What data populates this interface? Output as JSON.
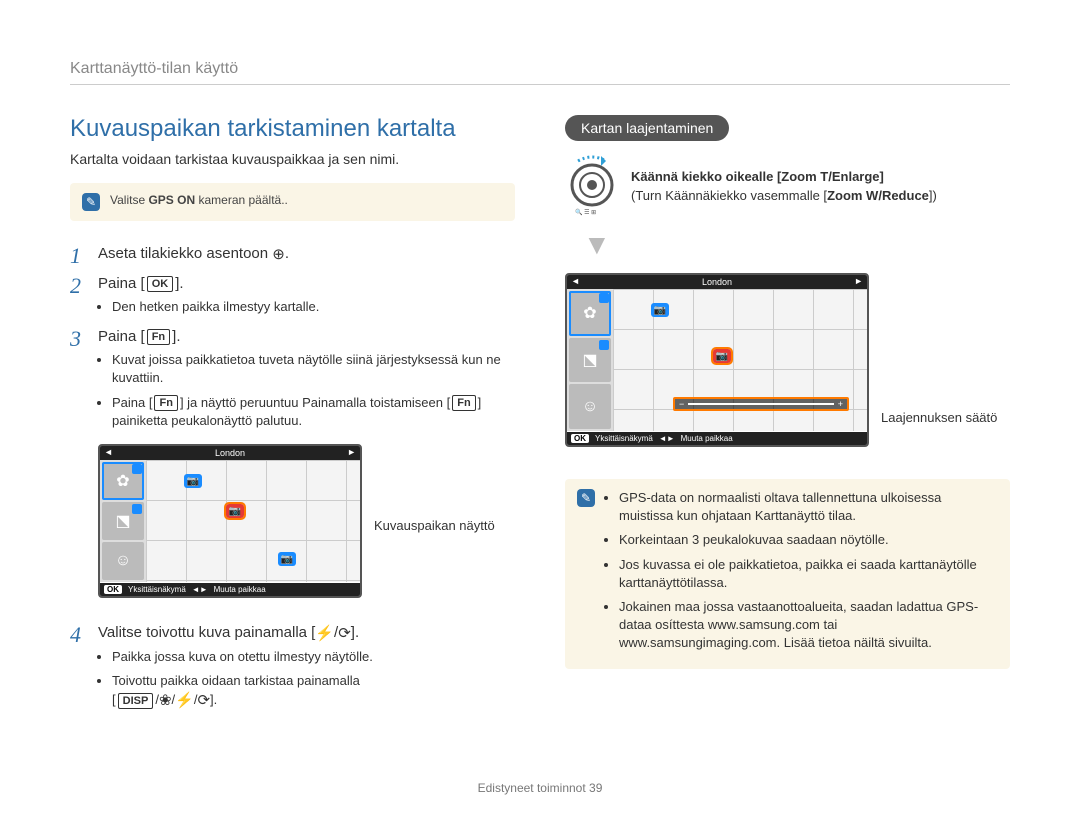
{
  "header": {
    "breadcrumb": "Karttanäyttö-tilan käyttö"
  },
  "left": {
    "title": "Kuvauspaikan tarkistaminen kartalta",
    "subtitle": "Kartalta voidaan tarkistaa kuvauspaikkaa ja sen nimi.",
    "note_prefix": "Valitse ",
    "note_bold": "GPS ON",
    "note_suffix": " kameran päältä..",
    "step1": "Aseta tilakiekko asentoon ",
    "step2": "Paina [",
    "step2_key": "OK",
    "step2_end": "].",
    "step2_bullet": "Den hetken paikka ilmestyy kartalle.",
    "step3": "Paina [",
    "step3_key": "Fn",
    "step3_end": "].",
    "step3_b1": "Kuvat joissa paikkatietoa tuveta näytölle siinä järjestyksessä kun ne kuvattiin.",
    "step3_b2_a": "Paina [",
    "step3_b2_key1": "Fn",
    "step3_b2_b": "] ja näyttö peruuntuu Painamalla toistamiseen [",
    "step3_b2_key2": "Fn",
    "step3_b2_c": "] painiketta peukalonäyttö palutuu.",
    "screenshot": {
      "city": "London",
      "ok_key": "OK",
      "ok_label": "Yksittäisnäkymä",
      "move_label": "Muuta paikkaa"
    },
    "annot1": "Kuvauspaikan näyttö",
    "step4_a": "Valitse toivottu kuva painamalla [",
    "step4_b": "].",
    "step4_bullet1": "Paikka jossa kuva on otettu ilmestyy näytölle.",
    "step4_bullet2_a": "Toivottu paikka oidaan tarkistaa painamalla",
    "step4_bullet2_b": "[",
    "step4_key_disp": "DISP",
    "step4_bullet2_c": "]."
  },
  "right": {
    "pill": "Kartan laajentaminen",
    "dial_line1_a": "Käännä kiekko oikealle [Zoom T/Enlarge]",
    "dial_line2_a": "(Turn Käännäkiekko vasemmalle [",
    "dial_line2_bold": "Zoom W/Reduce",
    "dial_line2_b": "])",
    "screenshot": {
      "city": "London",
      "ok_key": "OK",
      "ok_label": "Yksittäisnäkymä",
      "move_label": "Muuta paikkaa"
    },
    "annot2": "Laajennuksen säätö",
    "note_items": [
      "GPS-data on normaalisti oltava tallennettuna ulkoisessa muistissa kun ohjataan Karttanäyttö tilaa.",
      "Korkeintaan 3 peukalokuvaa saadaan nöytölle.",
      "Jos kuvassa ei ole paikkatietoa, paikka ei saada karttanäytölle karttanäyttötilassa.",
      "Jokainen maa jossa vastaanottoalueita, saadan ladattua GPS-dataa osíttesta www.samsung.com tai www.samsungimaging.com. Lisää tietoa näiltä sivuilta."
    ]
  },
  "footer": {
    "section": "Edistyneet toiminnot",
    "page": "39"
  }
}
